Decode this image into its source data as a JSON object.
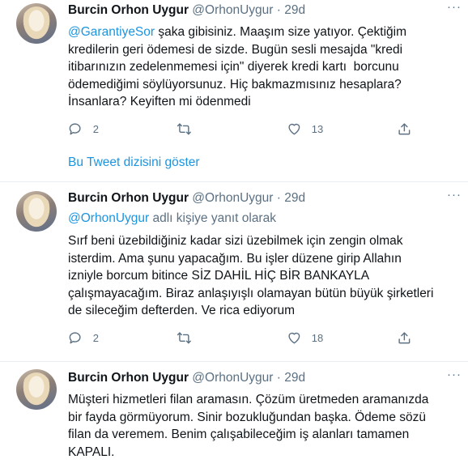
{
  "tweets": [
    {
      "name": "Burcin Orhon Uygur",
      "handle": "@OrhonUygur",
      "sep": "·",
      "time": "29d",
      "mention": "@GarantiyeSor",
      "text": " şaka gibisiniz. Maaşım size yatıyor. Çektiğim\nkredilerin geri ödemesi de sizde. Bugün sesli mesajda \"kredi\nitibarınızın zedelenmemesi için\" diyerek kredi kartı  borcunu\nödemediğimi söylüyorsunuz. Hiç bakmazmısınız hesaplara?\nİnsanlara? Keyiften mi ödenmedi",
      "replies": "2",
      "likes": "13"
    },
    {
      "name": "Burcin Orhon Uygur",
      "handle": "@OrhonUygur",
      "sep": "·",
      "time": "29d",
      "reply_mention": "@OrhonUygur",
      "reply_suffix": " adlı kişiye yanıt olarak",
      "text": "Sırf beni üzebildiğiniz kadar sizi üzebilmek için zengin olmak\nisterdim. Ama şunu yapacağım. Bu işler düzene girip Allahın\nizniyle borcum bitince SİZ DAHİL HİÇ BİR BANKAYLA\nçalışmayacağım. Biraz anlaşıyışlı olamayan bütün büyük şirketleri\nde sileceğim defterden. Ve rica ediyorum",
      "replies": "2",
      "likes": "18"
    },
    {
      "name": "Burcin Orhon Uygur",
      "handle": "@OrhonUygur",
      "sep": "·",
      "time": "29d",
      "text": "Müşteri hizmetleri filan aramasın. Çözüm üretmeden aramanızda\nbir fayda görmüyorum. Sinir bozukluğundan başka. Ödeme sözü\nfilan da veremem. Benim çalışabileceğim iş alanları tamamen\nKAPALI."
    }
  ],
  "thread_link": "Bu Tweet dizisini göster",
  "icons": [
    "more-icon",
    "reply-icon",
    "retweet-icon",
    "like-icon",
    "share-icon"
  ]
}
